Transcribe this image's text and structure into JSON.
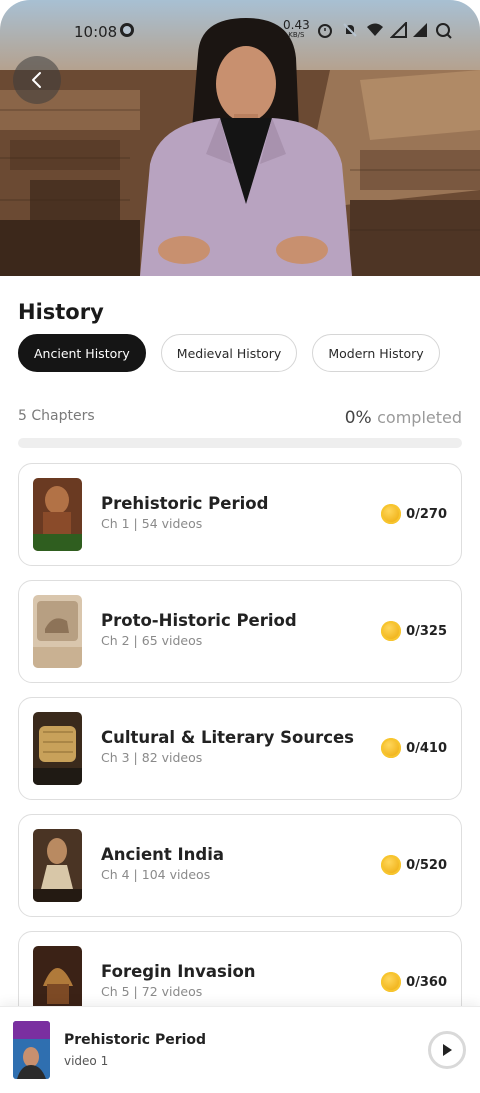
{
  "status_bar": {
    "time": "10:08",
    "net_speed_value": "0.43",
    "net_speed_unit": "KB/S"
  },
  "subject": {
    "title": "History"
  },
  "tabs": [
    {
      "label": "Ancient History",
      "selected": true
    },
    {
      "label": "Medieval History",
      "selected": false
    },
    {
      "label": "Modern History",
      "selected": false
    }
  ],
  "summary": {
    "chapters": "5 Chapters",
    "percent": "0%",
    "completed_label": "completed",
    "progress_fraction": 0
  },
  "chapters": [
    {
      "title": "Prehistoric Period",
      "meta": "Ch 1 | 54 videos",
      "coins": "0/270"
    },
    {
      "title": "Proto-Historic Period",
      "meta": "Ch 2 | 65 videos",
      "coins": "0/325"
    },
    {
      "title": "Cultural & Literary Sources",
      "meta": "Ch 3 | 82 videos",
      "coins": "0/410"
    },
    {
      "title": "Ancient India",
      "meta": "Ch 4 | 104 videos",
      "coins": "0/520"
    },
    {
      "title": "Foregin Invasion",
      "meta": "Ch 5 | 72 videos",
      "coins": "0/360"
    }
  ],
  "mini_player": {
    "title": "Prehistoric Period",
    "subtitle": "video 1"
  },
  "icons": {
    "back": "chevron-left-icon",
    "coin": "coin-icon",
    "play": "play-icon"
  },
  "colors": {
    "active_tab": "#151515",
    "coin": "#f0b21a",
    "progress_track": "#eeeeee"
  }
}
